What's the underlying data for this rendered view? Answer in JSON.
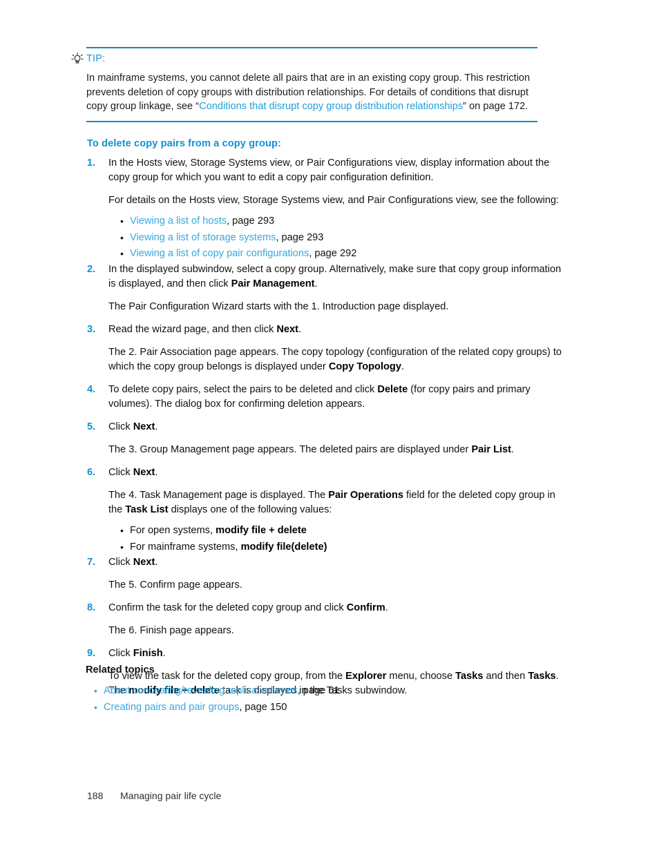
{
  "tip": {
    "icon": "lightbulb-icon",
    "label": "TIP:",
    "body_part1": "In mainframe systems, you cannot delete all pairs that are in an existing copy group. This restriction prevents deletion of copy groups with distribution relationships. For details of conditions that disrupt copy group linkage, see “",
    "body_link": "Conditions that disrupt copy group distribution relationships",
    "body_part2": "” on page 172."
  },
  "section": {
    "heading": "To delete copy pairs from a copy group:"
  },
  "steps": [
    {
      "num": "1.",
      "text": "In the Hosts view, Storage Systems view, or Pair Configurations view, display information about the copy group for which you want to edit a copy pair configuration definition."
    },
    {
      "num": "2.",
      "text_part1": "In the displayed subwindow, select a copy group. Alternatively, make sure that copy group information is displayed, and then click ",
      "bold1": "Pair Management",
      "text_part2": "."
    },
    {
      "num": "3.",
      "text_part1": "Read the wizard page, and then click ",
      "bold1": "Next",
      "text_part2": "."
    },
    {
      "num": "4.",
      "text_part1": "To delete copy pairs, select the pairs to be deleted and click ",
      "bold1": "Delete",
      "text_part2": " (for copy pairs and primary volumes). The dialog box for confirming deletion appears."
    },
    {
      "num": "5.",
      "text_part1": "Click ",
      "bold1": "Next",
      "text_part2": "."
    },
    {
      "num": "6.",
      "text_part1": "Click ",
      "bold1": "Next",
      "text_part2": "."
    },
    {
      "num": "7.",
      "text_part1": "Click ",
      "bold1": "Next",
      "text_part2": "."
    },
    {
      "num": "8.",
      "text_part1": "Confirm the task for the deleted copy group and click ",
      "bold1": "Confirm",
      "text_part2": "."
    },
    {
      "num": "9.",
      "text_part1": "Click ",
      "bold1": "Finish",
      "text_part2": "."
    }
  ],
  "paras": {
    "after_step1": "For details on the Hosts view, Storage Systems view, and Pair Configurations view, see the following:",
    "after_step2": "The Pair Configuration Wizard starts with the 1. Introduction page displayed.",
    "after_step3_a": "The 2. Pair Association page appears. The copy topology (configuration of the related copy groups) to which the copy group belongs is displayed under ",
    "after_step3_bold": "Copy Topology",
    "after_step3_b": ".",
    "after_step5_a": "The 3. Group Management page appears. The deleted pairs are displayed under ",
    "after_step5_bold": "Pair List",
    "after_step5_b": ".",
    "after_step6_a": "The 4. Task Management page is displayed. The ",
    "after_step6_bold1": "Pair Operations",
    "after_step6_b": " field for the deleted copy group in the ",
    "after_step6_bold2": "Task List",
    "after_step6_c": " displays one of the following values:",
    "after_step7": "The 5. Confirm page appears.",
    "after_step8": "The 6. Finish page appears.",
    "after_step9_a": "To view the task for the deleted copy group, from the ",
    "after_step9_bold1": "Explorer",
    "after_step9_b": " menu, choose ",
    "after_step9_bold2": "Tasks",
    "after_step9_c": " and then ",
    "after_step9_bold3": "Tasks",
    "after_step9_d": ". The ",
    "after_step9_bold4": "modify file + delete",
    "after_step9_e": "  task is displayed in the Tasks subwindow."
  },
  "step1_links": [
    {
      "bullet": "•",
      "link": "Viewing a list of hosts",
      "suffix": ", page 293"
    },
    {
      "bullet": "•",
      "link": "Viewing a list of storage systems",
      "suffix": ", page 293"
    },
    {
      "bullet": "•",
      "link": "Viewing a list of copy pair configurations",
      "suffix": ", page 292"
    }
  ],
  "step6_values": [
    {
      "bullet": "•",
      "prefix": "For open systems, ",
      "bold": "modify file + delete"
    },
    {
      "bullet": "•",
      "prefix": "For mainframe systems, ",
      "bold": "modify file(delete)"
    }
  ],
  "related": {
    "title": "Related topics",
    "items": [
      {
        "bullet": "•",
        "link": "About concealing/revealing replica volumes",
        "suffix": ", page 61"
      },
      {
        "bullet": "•",
        "link": "Creating pairs and pair groups",
        "suffix": ", page 150"
      }
    ]
  },
  "footer": {
    "page_number": "188",
    "chapter_title": "Managing pair life cycle"
  },
  "colors": {
    "heading_blue": "#0f93d2",
    "link_blue": "#35a8df",
    "rule_blue": "#1387c4",
    "body_text": "#111111"
  }
}
